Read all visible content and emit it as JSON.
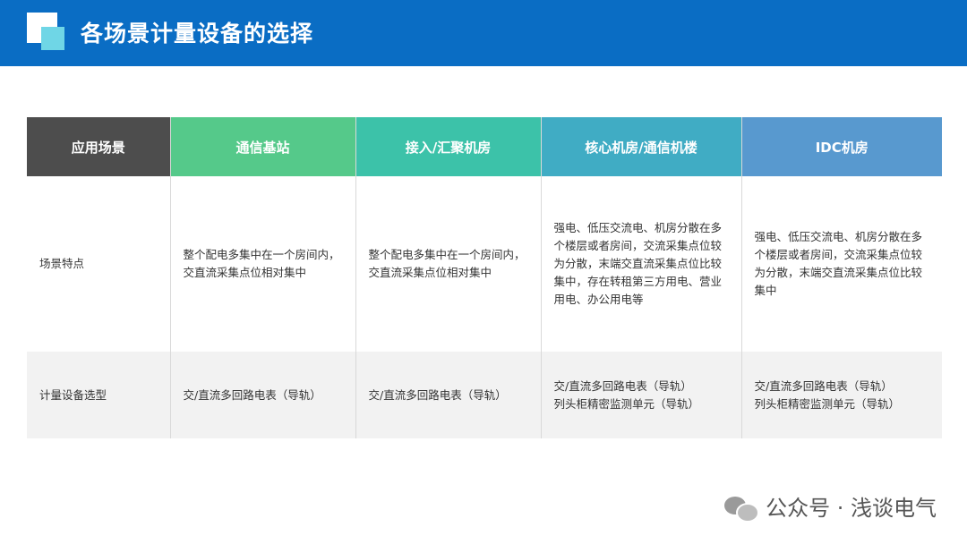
{
  "header": {
    "title": "各场景计量设备的选择"
  },
  "table": {
    "columns": [
      "应用场景",
      "通信基站",
      "接入/汇聚机房",
      "核心机房/通信机楼",
      "IDC机房"
    ],
    "rows": [
      {
        "label": "场景特点",
        "cells": [
          "整个配电多集中在一个房间内，交直流采集点位相对集中",
          "整个配电多集中在一个房间内，交直流采集点位相对集中",
          "强电、低压交流电、机房分散在多个楼层或者房间，交流采集点位较为分散，末端交直流采集点位比较集中，存在转租第三方用电、营业用电、办公用电等",
          "强电、低压交流电、机房分散在多个楼层或者房间，交流采集点位较为分散，末端交直流采集点位比较集中"
        ]
      },
      {
        "label": "计量设备选型",
        "cells": [
          "交/直流多回路电表（导轨）",
          "交/直流多回路电表（导轨）",
          [
            "交/直流多回路电表（导轨）",
            "列头柜精密监测单元（导轨）"
          ],
          [
            "交/直流多回路电表（导轨）",
            "列头柜精密监测单元（导轨）"
          ]
        ]
      }
    ]
  },
  "footer": {
    "label": "公众号 · 浅谈电气",
    "icon": "wechat-icon"
  }
}
